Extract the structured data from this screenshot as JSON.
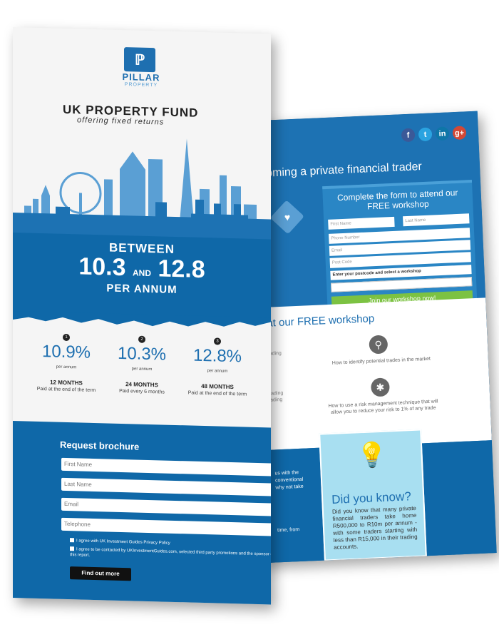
{
  "front": {
    "logo": {
      "brand": "PILLAR",
      "tagline": "PROPERTY"
    },
    "title": "UK PROPERTY FUND",
    "subtitle": "offering fixed returns",
    "hero": {
      "between": "BETWEEN",
      "low": "10.3",
      "and": "AND",
      "high": "12.8",
      "per_annum": "PER ANNUM"
    },
    "rates": [
      {
        "index": "1",
        "value": "10.9%",
        "pa": "per annum",
        "term": "12 MONTHS",
        "paid": "Paid at the end of the term"
      },
      {
        "index": "2",
        "value": "10.3%",
        "pa": "per annum",
        "term": "24 MONTHS",
        "paid": "Paid every 6 months"
      },
      {
        "index": "3",
        "value": "12.8%",
        "pa": "per annum",
        "term": "48 MONTHS",
        "paid": "Paid at the end of the term"
      }
    ],
    "form": {
      "title": "Request brochure",
      "first_name": "First Name",
      "last_name": "Last Name",
      "email": "Email",
      "telephone": "Telephone",
      "consent1": "I agree with UK Investment Guides Privacy Policy",
      "consent2": "I agree to be contacted by UKInvestmentGuides.com, selected third party promotions and the sponsor of this report.",
      "submit": "Find out more"
    }
  },
  "back": {
    "social": [
      {
        "name": "facebook",
        "glyph": "f",
        "color": "#3b5998"
      },
      {
        "name": "twitter",
        "glyph": "t",
        "color": "#2aa3e0"
      },
      {
        "name": "linkedin",
        "glyph": "in",
        "color": "#0e76a8"
      },
      {
        "name": "googleplus",
        "glyph": "g+",
        "color": "#d34836"
      }
    ],
    "title": "coming a private financial trader",
    "form": {
      "title": "Complete the form to attend our FREE workshop",
      "first_name": "First Name",
      "last_name": "Last Name",
      "phone": "Phone Number",
      "email": "Email",
      "postcode": "Post Code",
      "select": "Enter your postcode and select a workshop",
      "submit": "Join our workshop now!"
    },
    "section_title": "at our FREE workshop",
    "features": [
      {
        "icon": "search-icon",
        "text": "How to identify potential trades in the market"
      },
      {
        "icon": "lightbulb-icon",
        "text": "How to use a risk management technique that will allow you to reduce your risk to 1% of any trade"
      }
    ],
    "fragments": {
      "f1": "s of trading",
      "f2": "s of trading",
      "f3": "to trading",
      "f4": "us with the",
      "f5": "conventional",
      "f6": "why not take",
      "f7": "time, from"
    },
    "dyk": {
      "title": "Did you know?",
      "text": "Did you know that many private financial traders take home R500,000 to R10m per annum - with some traders starting with less than R15,000 in their trading accounts."
    }
  }
}
